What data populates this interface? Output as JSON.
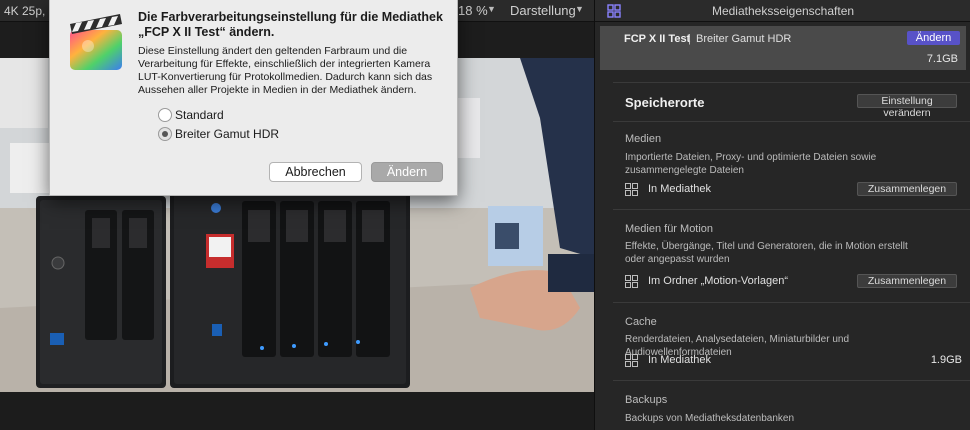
{
  "viewer": {
    "format": "4K 25p,",
    "zoom": "18 %",
    "view_menu": "Darstellung"
  },
  "dialog": {
    "title": "Die Farbverarbeitungseinstellung für die Mediathek „FCP X II Test“ ändern.",
    "body": "Diese Einstellung ändert den geltenden Farbraum und die Verarbeitung für Effekte, einschließlich der integrierten Kamera LUT-Konvertierung für Protokollmedien. Dadurch kann sich das Aussehen aller Projekte in Medien in der Mediathek ändern.",
    "options": [
      {
        "label": "Standard",
        "checked": false
      },
      {
        "label": "Breiter Gamut HDR",
        "checked": true
      }
    ],
    "cancel_label": "Abbrechen",
    "confirm_label": "Ändern"
  },
  "inspector": {
    "title": "Mediatheksseigenschaften",
    "library": {
      "name": "FCP X II Test",
      "separator": "|",
      "gamut": "Breiter Gamut HDR",
      "change_label": "Ändern",
      "size": "7.1GB"
    },
    "storage": {
      "title": "Speicherorte",
      "change_setting_label": "Einstellung verändern"
    },
    "media": {
      "title": "Medien",
      "description": "Importierte Dateien, Proxy- und optimierte Dateien sowie zusammengelegte Dateien",
      "location": "In Mediathek",
      "button": "Zusammenlegen"
    },
    "motion": {
      "title": "Medien für Motion",
      "description": "Effekte, Übergänge, Titel und Generatoren, die in Motion erstellt oder angepasst wurden",
      "location": "Im Ordner „Motion-Vorlagen“",
      "button": "Zusammenlegen"
    },
    "cache": {
      "title": "Cache",
      "description": "Renderdateien, Analysedateien, Miniaturbilder und Audiowellenformdateien",
      "location": "In Mediathek",
      "size": "1.9GB"
    },
    "backups": {
      "title": "Backups",
      "description": "Backups von Mediatheksdatenbanken"
    }
  },
  "colors": {
    "accent_purple": "#5852c8",
    "panel_bg": "#262626"
  }
}
